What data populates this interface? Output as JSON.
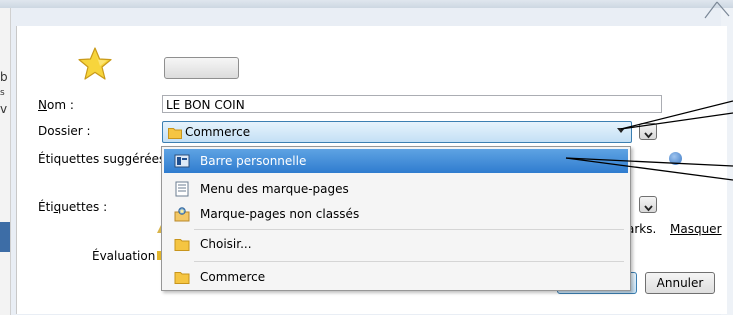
{
  "background": {
    "left_letters": [
      "b",
      "s",
      "v"
    ]
  },
  "dialog": {
    "name_label_pre": "",
    "name_label_u": "N",
    "name_label_post": "om :",
    "name_value": "LE BON COIN",
    "folder_label": "Dossier :",
    "folder_value": "Commerce",
    "suggested_tags_label": "Étiquettes suggérées :",
    "tags_label_pre": "Éti",
    "tags_label_u": "q",
    "tags_label_post": "uettes :",
    "rating_label": "Évaluation :",
    "partial_text": "arks.",
    "hide_link": "Masquer",
    "cancel_button": "Annuler"
  },
  "dropdown": {
    "items": [
      {
        "label": "Barre personnelle",
        "icon": "toolbar-icon",
        "selected": true
      },
      {
        "label": "Menu des marque-pages",
        "icon": "bookmarks-menu-icon",
        "selected": false
      },
      {
        "label": "Marque-pages non classés",
        "icon": "unsorted-bookmarks-icon",
        "selected": false
      },
      {
        "label": "Choisir...",
        "icon": "folder-icon",
        "selected": false
      },
      {
        "label": "Commerce",
        "icon": "folder-icon",
        "selected": false
      }
    ]
  },
  "colors": {
    "selection": "#3a86d6",
    "folder": "#f5c542",
    "star": "#f7d53c"
  }
}
